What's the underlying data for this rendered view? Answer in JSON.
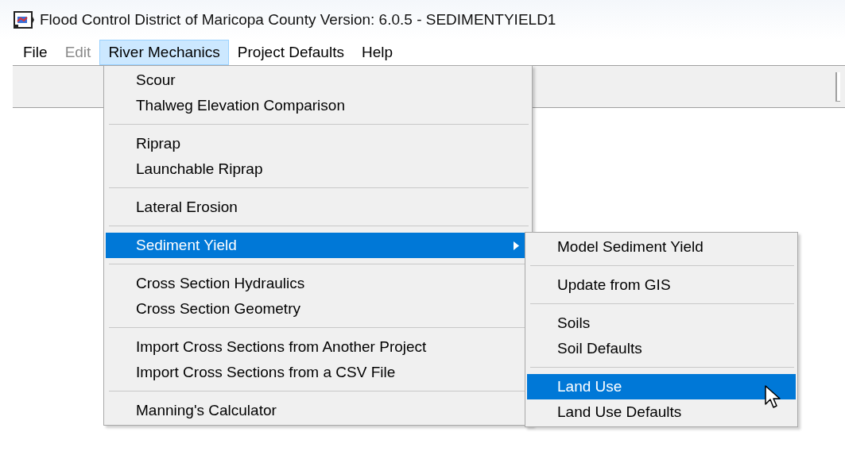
{
  "window": {
    "title": "Flood Control District of Maricopa County Version: 6.0.5 - SEDIMENTYIELD1"
  },
  "menu_bar": [
    {
      "label": "File",
      "selected": false,
      "disabled": false
    },
    {
      "label": "Edit",
      "selected": false,
      "disabled": true
    },
    {
      "label": "River Mechanics",
      "selected": true,
      "disabled": false
    },
    {
      "label": "Project Defaults",
      "selected": false,
      "disabled": false
    },
    {
      "label": "Help",
      "selected": false,
      "disabled": false
    }
  ],
  "menu": {
    "items": [
      {
        "kind": "item",
        "label": "Scour",
        "selected": false
      },
      {
        "kind": "item",
        "label": "Thalweg Elevation Comparison",
        "selected": false
      },
      {
        "kind": "separator"
      },
      {
        "kind": "item",
        "label": "Riprap",
        "selected": false
      },
      {
        "kind": "item",
        "label": "Launchable Riprap",
        "selected": false
      },
      {
        "kind": "separator"
      },
      {
        "kind": "item",
        "label": "Lateral Erosion",
        "selected": false
      },
      {
        "kind": "separator"
      },
      {
        "kind": "submenu",
        "label": "Sediment Yield",
        "selected": true
      },
      {
        "kind": "separator"
      },
      {
        "kind": "item",
        "label": "Cross Section Hydraulics",
        "selected": false
      },
      {
        "kind": "item",
        "label": "Cross Section Geometry",
        "selected": false
      },
      {
        "kind": "separator"
      },
      {
        "kind": "item",
        "label": "Import Cross Sections from Another Project",
        "selected": false
      },
      {
        "kind": "item",
        "label": "Import Cross Sections from a CSV File",
        "selected": false
      },
      {
        "kind": "separator"
      },
      {
        "kind": "item",
        "label": "Manning's Calculator",
        "selected": false
      }
    ]
  },
  "submenu": {
    "items": [
      {
        "kind": "item",
        "label": "Model Sediment Yield",
        "selected": false
      },
      {
        "kind": "separator"
      },
      {
        "kind": "item",
        "label": "Update from GIS",
        "selected": false
      },
      {
        "kind": "separator"
      },
      {
        "kind": "item",
        "label": "Soils",
        "selected": false
      },
      {
        "kind": "item",
        "label": "Soil Defaults",
        "selected": false
      },
      {
        "kind": "separator"
      },
      {
        "kind": "item",
        "label": "Land Use",
        "selected": true
      },
      {
        "kind": "item",
        "label": "Land Use Defaults",
        "selected": false
      }
    ]
  }
}
